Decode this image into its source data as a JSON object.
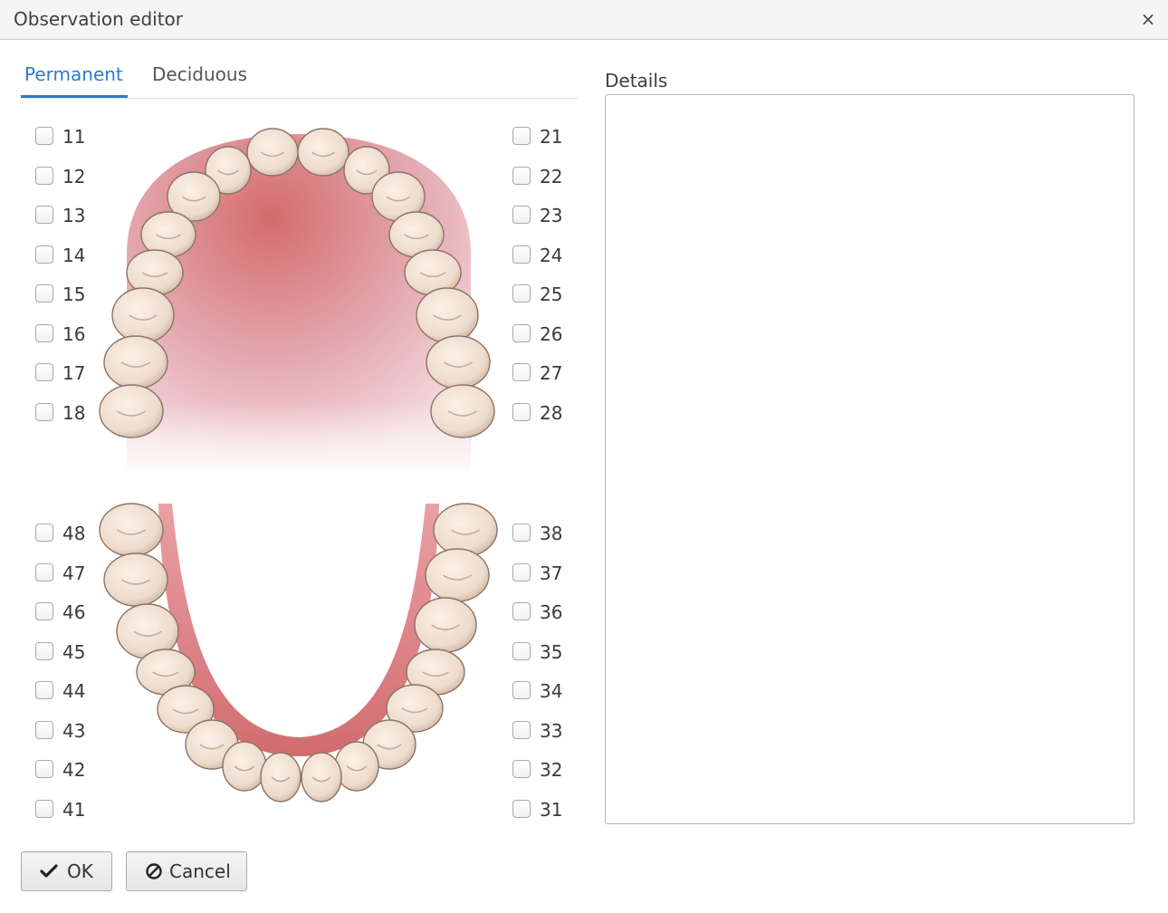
{
  "window": {
    "title": "Observation editor",
    "close_glyph": "×"
  },
  "tabs": [
    {
      "label": "Permanent",
      "active": true
    },
    {
      "label": "Deciduous",
      "active": false
    }
  ],
  "teeth": {
    "upper_left": [
      "11",
      "12",
      "13",
      "14",
      "15",
      "16",
      "17",
      "18"
    ],
    "upper_right": [
      "21",
      "22",
      "23",
      "24",
      "25",
      "26",
      "27",
      "28"
    ],
    "lower_left": [
      "48",
      "47",
      "46",
      "45",
      "44",
      "43",
      "42",
      "41"
    ],
    "lower_right": [
      "38",
      "37",
      "36",
      "35",
      "34",
      "33",
      "32",
      "31"
    ]
  },
  "details": {
    "label": "Details",
    "value": ""
  },
  "buttons": {
    "ok": "OK",
    "cancel": "Cancel"
  },
  "colors": {
    "accent": "#2b7cc8",
    "gum": "#d06a6a",
    "tooth": "#efdfd2"
  }
}
